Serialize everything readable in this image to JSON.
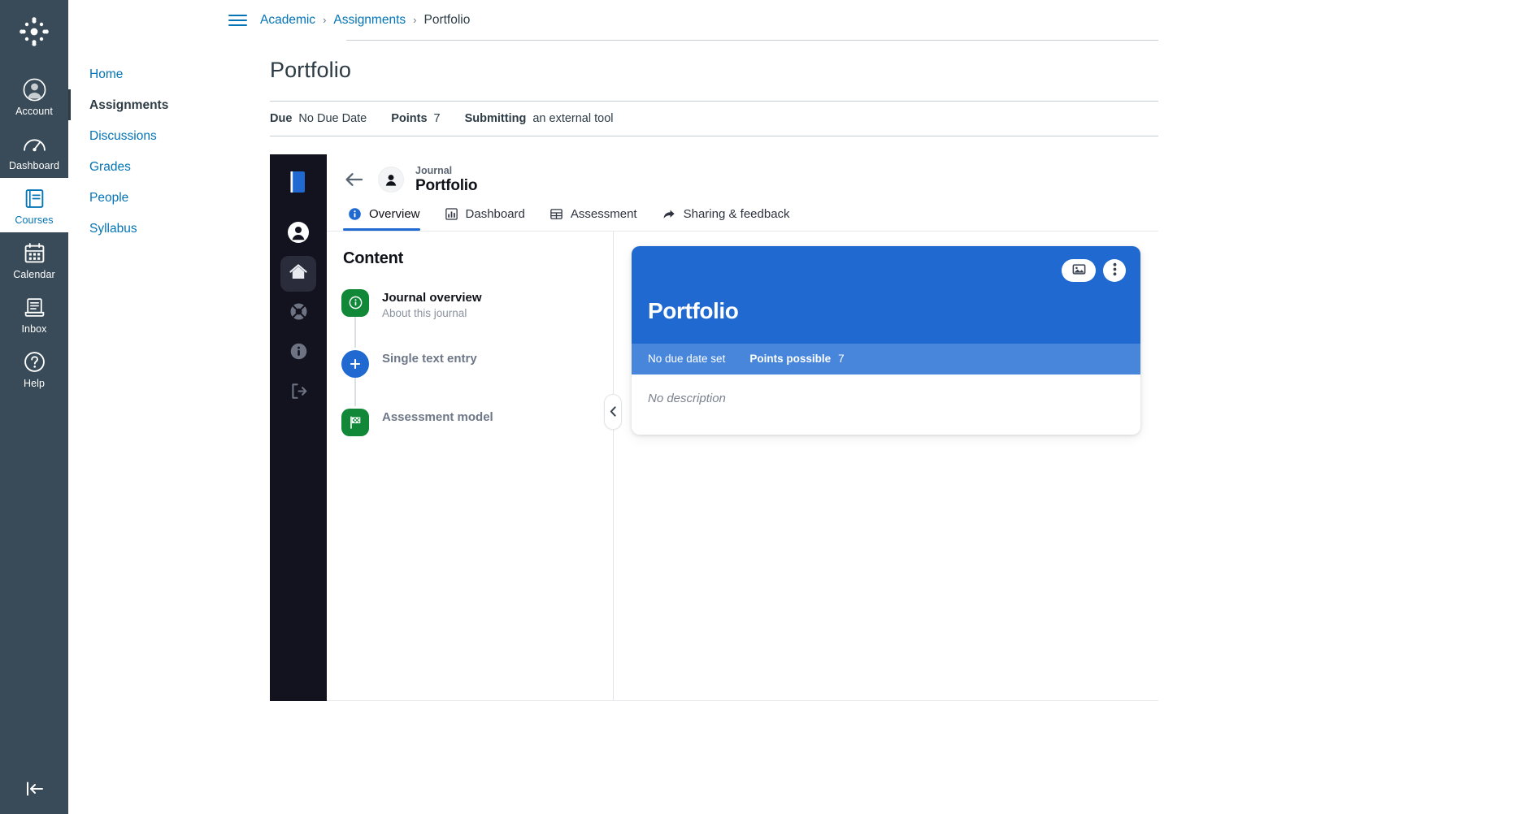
{
  "global_nav": {
    "logo_name": "canvas-logo",
    "items": [
      {
        "label": "Account",
        "icon": "account-icon",
        "active": false
      },
      {
        "label": "Dashboard",
        "icon": "dashboard-icon",
        "active": false
      },
      {
        "label": "Courses",
        "icon": "courses-icon",
        "active": true
      },
      {
        "label": "Calendar",
        "icon": "calendar-icon",
        "active": false
      },
      {
        "label": "Inbox",
        "icon": "inbox-icon",
        "active": false
      },
      {
        "label": "Help",
        "icon": "help-icon",
        "active": false
      }
    ],
    "collapse_icon": "collapse-left-icon"
  },
  "course_nav": {
    "items": [
      {
        "label": "Home",
        "active": false
      },
      {
        "label": "Assignments",
        "active": true
      },
      {
        "label": "Discussions",
        "active": false
      },
      {
        "label": "Grades",
        "active": false
      },
      {
        "label": "People",
        "active": false
      },
      {
        "label": "Syllabus",
        "active": false
      }
    ]
  },
  "breadcrumb": {
    "menu_icon": "hamburger-menu-icon",
    "items": [
      "Academic",
      "Assignments",
      "Portfolio"
    ],
    "separator": "›"
  },
  "assignment": {
    "title": "Portfolio",
    "meta": [
      {
        "key": "Due",
        "value": "No Due Date"
      },
      {
        "key": "Points",
        "value": "7"
      },
      {
        "key": "Submitting",
        "value": "an external tool"
      }
    ]
  },
  "tool": {
    "rail": {
      "logo_icon": "book-logo-icon",
      "items": [
        {
          "icon": "user-avatar-icon",
          "active": false
        },
        {
          "icon": "home-icon",
          "active": true
        },
        {
          "icon": "life-ring-icon",
          "active": false
        },
        {
          "icon": "info-icon",
          "active": false
        },
        {
          "icon": "logout-icon",
          "active": false
        }
      ]
    },
    "header": {
      "back_icon": "back-arrow-icon",
      "avatar_icon": "user-avatar-icon",
      "kicker": "Journal",
      "title": "Portfolio"
    },
    "tabs": [
      {
        "label": "Overview",
        "icon": "info-circle-icon",
        "active": true
      },
      {
        "label": "Dashboard",
        "icon": "bar-chart-icon",
        "active": false
      },
      {
        "label": "Assessment",
        "icon": "grid-table-icon",
        "active": false
      },
      {
        "label": "Sharing & feedback",
        "icon": "share-arrow-icon",
        "active": false
      }
    ],
    "panel_left": {
      "heading": "Content",
      "collapse_icon": "chevron-left-icon",
      "items": [
        {
          "title": "Journal overview",
          "subtitle": "About this journal",
          "icon": "info-icon",
          "badge_shape": "square",
          "badge_color": "#108838",
          "muted": false
        },
        {
          "title": "Single text entry",
          "subtitle": "",
          "icon": "plus-icon",
          "badge_shape": "circle",
          "badge_color": "#2069D0",
          "muted": true
        },
        {
          "title": "Assessment model",
          "subtitle": "",
          "icon": "checkered-flag-icon",
          "badge_shape": "square",
          "badge_color": "#108838",
          "muted": true
        }
      ]
    },
    "card": {
      "title": "Portfolio",
      "image_button_icon": "image-icon",
      "menu_button_icon": "kebab-menu-icon",
      "due": "No due date set",
      "points_label": "Points possible",
      "points_value": "7",
      "description": "No description"
    }
  },
  "colors": {
    "canvas_nav_bg": "#394B58",
    "canvas_link": "#0374B5",
    "tool_rail_bg": "#12131F",
    "accent_blue": "#2069D0",
    "meta_blue": "#4786DB",
    "green": "#108838"
  }
}
